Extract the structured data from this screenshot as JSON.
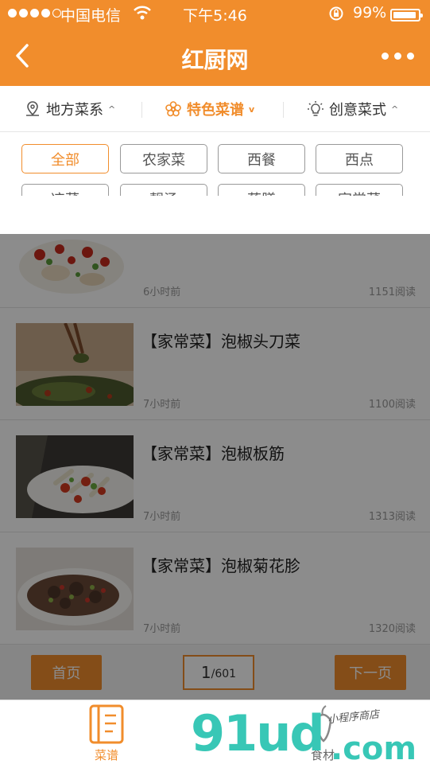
{
  "status_bar": {
    "carrier": "中国电信",
    "time": "下午5:46",
    "battery": "99%"
  },
  "navbar": {
    "title": "红厨网",
    "back_icon": "chevron-left-icon",
    "more_icon": "more-dots-icon"
  },
  "filters": [
    {
      "label": "地方菜系",
      "icon": "location-pin-icon",
      "active": false
    },
    {
      "label": "特色菜谱",
      "icon": "flower-icon",
      "active": true
    },
    {
      "label": "创意菜式",
      "icon": "lightbulb-icon",
      "active": false
    }
  ],
  "tags": [
    {
      "label": "全部",
      "active": true
    },
    {
      "label": "农家菜",
      "active": false
    },
    {
      "label": "西餐",
      "active": false
    },
    {
      "label": "西点",
      "active": false
    },
    {
      "label": "凉菜",
      "active": false
    },
    {
      "label": "靓汤",
      "active": false
    },
    {
      "label": "药膳",
      "active": false
    },
    {
      "label": "家常菜",
      "active": false
    }
  ],
  "list": [
    {
      "title": "",
      "time": "6小时前",
      "reads": "1151阅读"
    },
    {
      "title": "【家常菜】泡椒头刀菜",
      "time": "7小时前",
      "reads": "1100阅读"
    },
    {
      "title": "【家常菜】泡椒板筋",
      "time": "7小时前",
      "reads": "1313阅读"
    },
    {
      "title": "【家常菜】泡椒菊花胗",
      "time": "7小时前",
      "reads": "1320阅读"
    }
  ],
  "pager": {
    "first": "首页",
    "current": "1",
    "total": "/601",
    "next": "下一页"
  },
  "tabbar": [
    {
      "label": "菜谱",
      "icon": "recipe-book-icon",
      "active": true
    },
    {
      "label": "食材",
      "icon": "ingredient-icon",
      "active": false
    }
  ],
  "watermark": {
    "main": "91ud",
    "suffix": ".com",
    "sub": "小程序商店"
  },
  "colors": {
    "accent": "#f18d2c",
    "overlay": "rgba(0,0,0,0.45)"
  }
}
